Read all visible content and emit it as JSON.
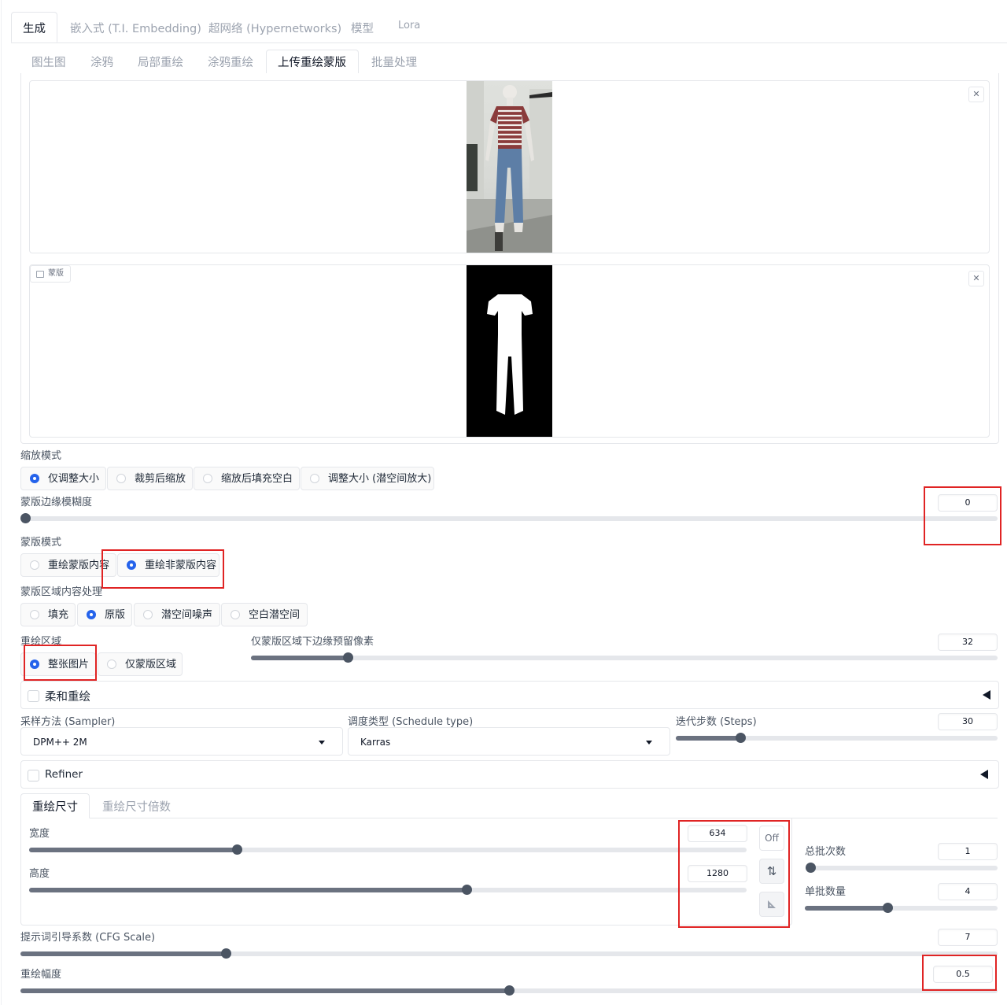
{
  "primary_tabs": [
    {
      "label": "生成",
      "active": true
    },
    {
      "label": "嵌入式 (T.I. Embedding)",
      "active": false
    },
    {
      "label": "超网络 (Hypernetworks)",
      "active": false
    },
    {
      "label": "模型",
      "active": false
    },
    {
      "label": "Lora",
      "active": false
    }
  ],
  "sub_tabs": [
    {
      "label": "图生图",
      "active": false
    },
    {
      "label": "涂鸦",
      "active": false
    },
    {
      "label": "局部重绘",
      "active": false
    },
    {
      "label": "涂鸦重绘",
      "active": false
    },
    {
      "label": "上传重绘蒙版",
      "active": true
    },
    {
      "label": "批量处理",
      "active": false
    }
  ],
  "mask_panel": {
    "label": "蒙版"
  },
  "resize_mode": {
    "label": "缩放模式",
    "options": [
      "仅调整大小",
      "裁剪后缩放",
      "缩放后填充空白",
      "调整大小 (潜空间放大)"
    ],
    "selected": "仅调整大小"
  },
  "mask_blur": {
    "label": "蒙版边缘模糊度",
    "value": "0",
    "fraction": 0
  },
  "mask_mode": {
    "label": "蒙版模式",
    "options": [
      "重绘蒙版内容",
      "重绘非蒙版内容"
    ],
    "selected": "重绘非蒙版内容"
  },
  "masked_content": {
    "label": "蒙版区域内容处理",
    "options": [
      "填充",
      "原版",
      "潜空间噪声",
      "空白潜空间"
    ],
    "selected": "原版"
  },
  "inpaint_area": {
    "label": "重绘区域",
    "options": [
      "整张图片",
      "仅蒙版区域"
    ],
    "selected": "整张图片"
  },
  "only_masked_padding": {
    "label": "仅蒙版区域下边缘预留像素",
    "value": "32",
    "fraction": 0.13
  },
  "soft_inpainting": {
    "label": "柔和重绘",
    "checked": false
  },
  "sampler": {
    "label": "采样方法 (Sampler)",
    "value": "DPM++ 2M"
  },
  "schedule": {
    "label": "调度类型 (Schedule type)",
    "value": "Karras"
  },
  "steps": {
    "label": "迭代步数 (Steps)",
    "value": "30",
    "fraction": 0.2
  },
  "refiner": {
    "label": "Refiner",
    "checked": false
  },
  "size_tabs": [
    {
      "label": "重绘尺寸",
      "active": true
    },
    {
      "label": "重绘尺寸倍数",
      "active": false
    }
  ],
  "width": {
    "label": "宽度",
    "value": "634",
    "fraction": 0.29
  },
  "height": {
    "label": "高度",
    "value": "1280",
    "fraction": 0.61
  },
  "aspect_lock": {
    "label": "Off"
  },
  "batch_count": {
    "label": "总批次数",
    "value": "1",
    "fraction": 0
  },
  "batch_size": {
    "label": "单批数量",
    "value": "4",
    "fraction": 0.43
  },
  "cfg_scale": {
    "label": "提示词引导系数 (CFG Scale)",
    "value": "7",
    "fraction": 0.21
  },
  "denoising": {
    "label": "重绘幅度",
    "value": "0.5",
    "fraction": 0.5
  }
}
